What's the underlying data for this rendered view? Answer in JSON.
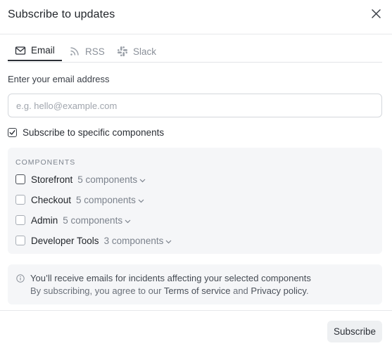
{
  "header": {
    "title": "Subscribe to updates",
    "close_icon": "close-icon"
  },
  "tabs": [
    {
      "label": "Email",
      "icon": "mail-icon",
      "active": true
    },
    {
      "label": "RSS",
      "icon": "rss-icon",
      "active": false
    },
    {
      "label": "Slack",
      "icon": "slack-icon",
      "active": false
    }
  ],
  "email": {
    "label": "Enter your email address",
    "placeholder": "e.g. hello@example.com",
    "value": ""
  },
  "specific_components": {
    "label": "Subscribe to specific components",
    "checked": true
  },
  "components": {
    "heading": "COMPONENTS",
    "items": [
      {
        "name": "Storefront",
        "count": "5 components",
        "checked": false
      },
      {
        "name": "Checkout",
        "count": "5 components",
        "checked": false
      },
      {
        "name": "Admin",
        "count": "5 components",
        "checked": false
      },
      {
        "name": "Developer Tools",
        "count": "3 components",
        "checked": false
      }
    ]
  },
  "info": {
    "icon": "info-icon",
    "line1": "You’ll receive emails for incidents affecting your selected components",
    "line2_prefix": "By subscribing, you agree to our",
    "terms_link": "Terms of service",
    "and": "and",
    "privacy_link": "Privacy policy",
    "period": "."
  },
  "footer": {
    "subscribe_label": "Subscribe"
  },
  "colors": {
    "text": "#1f2328",
    "muted": "#7b828c",
    "panel_bg": "#f5f6f8",
    "border": "#e6e8eb"
  }
}
